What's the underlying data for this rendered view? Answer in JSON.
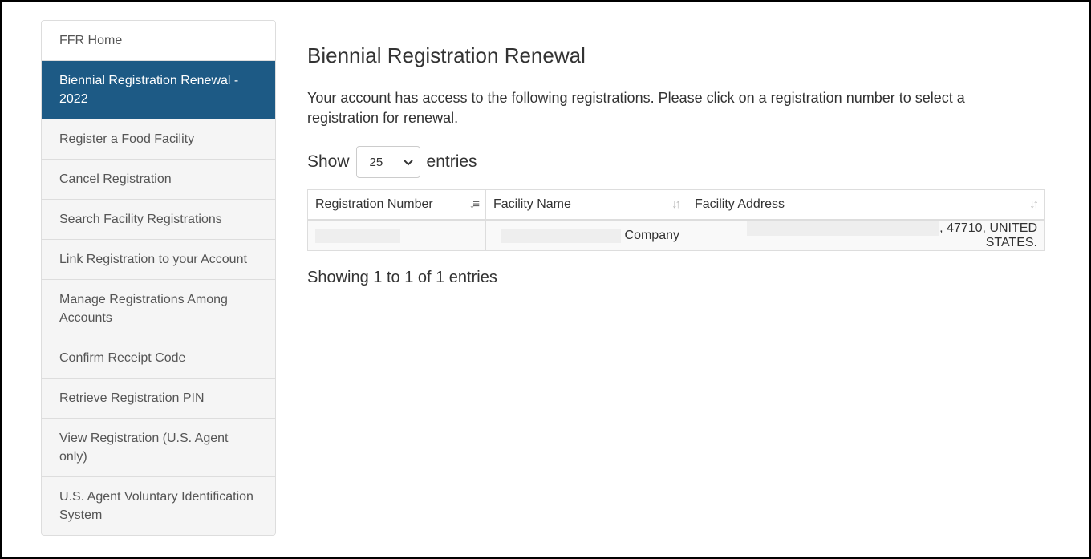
{
  "sidebar": {
    "items": [
      {
        "label": "FFR Home"
      },
      {
        "label": "Biennial Registration Renewal - 2022"
      },
      {
        "label": "Register a Food Facility"
      },
      {
        "label": "Cancel Registration"
      },
      {
        "label": "Search Facility Registrations"
      },
      {
        "label": "Link Registration to your Account"
      },
      {
        "label": "Manage Registrations Among Accounts"
      },
      {
        "label": "Confirm Receipt Code"
      },
      {
        "label": "Retrieve Registration PIN"
      },
      {
        "label": "View Registration (U.S. Agent only)"
      },
      {
        "label": "U.S. Agent Voluntary Identification System"
      }
    ],
    "active_index": 1,
    "active_color": "#1d5a85"
  },
  "main": {
    "title": "Biennial Registration Renewal",
    "description": "Your account has access to the following registrations. Please click on a registration number to select a registration for renewal.",
    "length": {
      "show_label": "Show",
      "value": "25",
      "entries_label": "entries"
    },
    "table": {
      "columns": [
        "Registration Number",
        "Facility Name",
        "Facility Address"
      ],
      "rows": [
        {
          "registration_number": "",
          "facility_name_suffix": "Company",
          "facility_address_suffix": ", 47710, UNITED STATES."
        }
      ]
    },
    "info": "Showing 1 to 1 of 1 entries"
  }
}
